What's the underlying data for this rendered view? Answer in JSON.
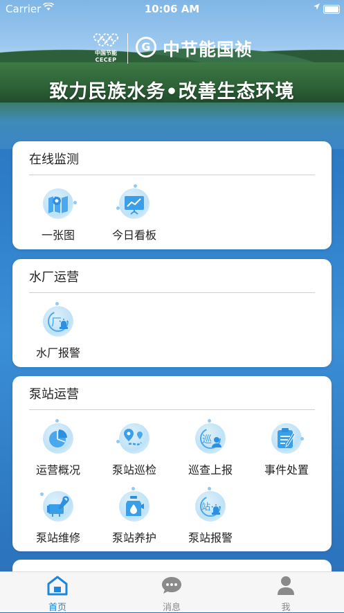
{
  "status_bar": {
    "carrier": "Carrier",
    "time": "10:06 AM"
  },
  "header": {
    "cecep_zh": "中国节能",
    "cecep_en": "CECEP",
    "brand_icon": "G",
    "brand_name": "中节能国祯",
    "slogan": "致力民族水务•改善生态环境"
  },
  "sections": [
    {
      "title": "在线监测",
      "items": [
        {
          "label": "一张图",
          "icon": "map-icon"
        },
        {
          "label": "今日看板",
          "icon": "dashboard-icon"
        }
      ]
    },
    {
      "title": "水厂运营",
      "items": [
        {
          "label": "水厂报警",
          "icon": "factory-alarm-icon"
        }
      ]
    },
    {
      "title": "泵站运营",
      "items": [
        {
          "label": "运营概况",
          "icon": "pie-chart-icon"
        },
        {
          "label": "泵站巡检",
          "icon": "route-pin-icon"
        },
        {
          "label": "巡查上报",
          "icon": "patrol-report-icon"
        },
        {
          "label": "事件处置",
          "icon": "event-edit-icon"
        },
        {
          "label": "泵站维修",
          "icon": "repair-wrench-icon"
        },
        {
          "label": "泵站养护",
          "icon": "maintenance-bottle-icon"
        },
        {
          "label": "泵站报警",
          "icon": "station-alarm-icon"
        }
      ]
    }
  ],
  "icon_glyphs": {
    "factory": "厂",
    "patrol": "巡",
    "station": "站"
  },
  "tabbar": [
    {
      "label": "首页",
      "icon": "home-icon",
      "active": true
    },
    {
      "label": "消息",
      "icon": "message-icon",
      "active": false
    },
    {
      "label": "我",
      "icon": "person-icon",
      "active": false
    }
  ],
  "colors": {
    "accent": "#1f86d8",
    "icon_blue": "#3a9ee8",
    "inactive": "#888888"
  }
}
